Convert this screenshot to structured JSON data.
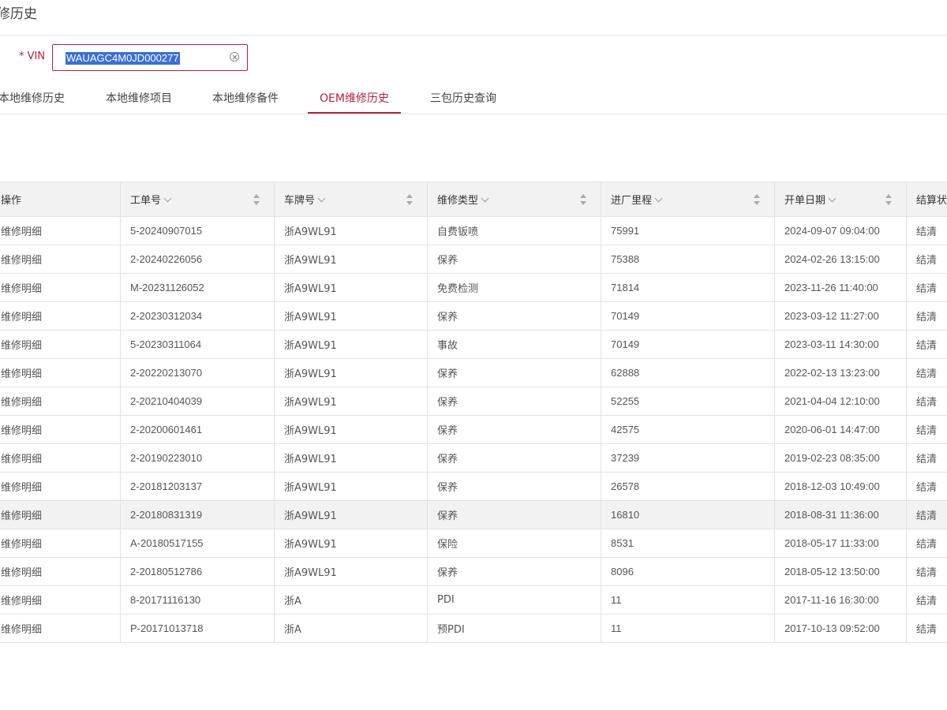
{
  "page_title": "修历史",
  "vin": {
    "label": "* VIN",
    "value": "WAUAGC4M0JD000277"
  },
  "tabs": [
    {
      "label": "本地维修历史"
    },
    {
      "label": "本地维修项目"
    },
    {
      "label": "本地维修备件"
    },
    {
      "label": "OEM维修历史",
      "active": true
    },
    {
      "label": "三包历史查询"
    }
  ],
  "table": {
    "columns": [
      "操作",
      "工单号",
      "车牌号",
      "维修类型",
      "进厂里程",
      "开单日期",
      "结算状态"
    ],
    "rows": [
      {
        "op": "维修明细",
        "order": "5-20240907015",
        "plate": "浙A9WL91",
        "type": "自费钣喷",
        "mileage": "75991",
        "date": "2024-09-07 09:04:00",
        "status": "结清"
      },
      {
        "op": "维修明细",
        "order": "2-20240226056",
        "plate": "浙A9WL91",
        "type": "保养",
        "mileage": "75388",
        "date": "2024-02-26 13:15:00",
        "status": "结清"
      },
      {
        "op": "维修明细",
        "order": "M-20231126052",
        "plate": "浙A9WL91",
        "type": "免费检测",
        "mileage": "71814",
        "date": "2023-11-26 11:40:00",
        "status": "结清"
      },
      {
        "op": "维修明细",
        "order": "2-20230312034",
        "plate": "浙A9WL91",
        "type": "保养",
        "mileage": "70149",
        "date": "2023-03-12 11:27:00",
        "status": "结清"
      },
      {
        "op": "维修明细",
        "order": "5-20230311064",
        "plate": "浙A9WL91",
        "type": "事故",
        "mileage": "70149",
        "date": "2023-03-11 14:30:00",
        "status": "结清"
      },
      {
        "op": "维修明细",
        "order": "2-20220213070",
        "plate": "浙A9WL91",
        "type": "保养",
        "mileage": "62888",
        "date": "2022-02-13 13:23:00",
        "status": "结清"
      },
      {
        "op": "维修明细",
        "order": "2-20210404039",
        "plate": "浙A9WL91",
        "type": "保养",
        "mileage": "52255",
        "date": "2021-04-04 12:10:00",
        "status": "结清"
      },
      {
        "op": "维修明细",
        "order": "2-20200601461",
        "plate": "浙A9WL91",
        "type": "保养",
        "mileage": "42575",
        "date": "2020-06-01 14:47:00",
        "status": "结清"
      },
      {
        "op": "维修明细",
        "order": "2-20190223010",
        "plate": "浙A9WL91",
        "type": "保养",
        "mileage": "37239",
        "date": "2019-02-23 08:35:00",
        "status": "结清"
      },
      {
        "op": "维修明细",
        "order": "2-20181203137",
        "plate": "浙A9WL91",
        "type": "保养",
        "mileage": "26578",
        "date": "2018-12-03 10:49:00",
        "status": "结清"
      },
      {
        "op": "维修明细",
        "order": "2-20180831319",
        "plate": "浙A9WL91",
        "type": "保养",
        "mileage": "16810",
        "date": "2018-08-31 11:36:00",
        "status": "结清",
        "highlight": true
      },
      {
        "op": "维修明细",
        "order": "A-20180517155",
        "plate": "浙A9WL91",
        "type": "保险",
        "mileage": "8531",
        "date": "2018-05-17 11:33:00",
        "status": "结清"
      },
      {
        "op": "维修明细",
        "order": "2-20180512786",
        "plate": "浙A9WL91",
        "type": "保养",
        "mileage": "8096",
        "date": "2018-05-12 13:50:00",
        "status": "结清"
      },
      {
        "op": "维修明细",
        "order": "8-20171116130",
        "plate": "浙A",
        "type": "PDI",
        "mileage": "11",
        "date": "2017-11-16 16:30:00",
        "status": "结清"
      },
      {
        "op": "维修明细",
        "order": "P-20171013718",
        "plate": "浙A",
        "type": "预PDI",
        "mileage": "11",
        "date": "2017-10-13 09:52:00",
        "status": "结清"
      }
    ]
  },
  "colors": {
    "accent": "#b0243d",
    "selection": "#3c6fd1",
    "header_bg": "#f2f2f2"
  },
  "icons": {
    "clear": "close-circle-icon",
    "filter": "chevron-down-icon",
    "sort": "sort-icon"
  }
}
